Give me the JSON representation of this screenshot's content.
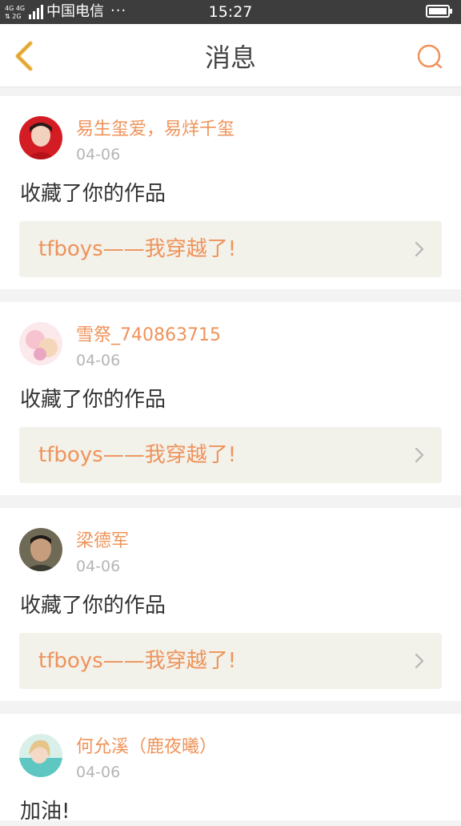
{
  "status_bar": {
    "network": "4G 4G 2G",
    "carrier": "中国电信",
    "dots": "···",
    "time": "15:27"
  },
  "header": {
    "title": "消息"
  },
  "colors": {
    "accent": "#ef935a",
    "back_arrow": "#f2b43a",
    "link_bg": "#f2f1ea"
  },
  "messages": [
    {
      "username": "易生玺爱，易烊千玺",
      "date": "04-06",
      "text": "收藏了你的作品",
      "work_title": "tfboys——我穿越了!"
    },
    {
      "username": "雪祭_740863715",
      "date": "04-06",
      "text": "收藏了你的作品",
      "work_title": "tfboys——我穿越了!"
    },
    {
      "username": "梁德军",
      "date": "04-06",
      "text": "收藏了你的作品",
      "work_title": "tfboys——我穿越了!"
    },
    {
      "username": "何允溪（鹿夜曦）",
      "date": "04-06",
      "text": "加油!"
    }
  ]
}
